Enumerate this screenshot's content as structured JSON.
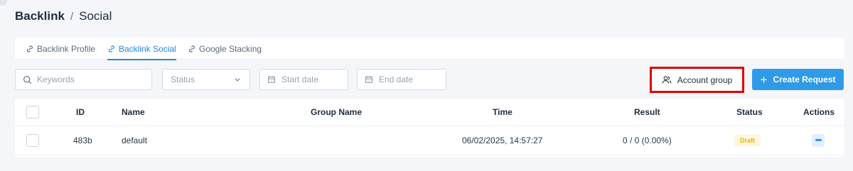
{
  "breadcrumb": {
    "root": "Backlink",
    "separator": "/",
    "current": "Social"
  },
  "tabs": [
    {
      "label": "Backlink Profile",
      "icon": "link-icon",
      "active": false
    },
    {
      "label": "Backlink Social",
      "icon": "link-icon",
      "active": true
    },
    {
      "label": "Google Stacking",
      "icon": "link-icon",
      "active": false
    }
  ],
  "filters": {
    "keywords_placeholder": "Keywords",
    "status_placeholder": "Status",
    "start_date_placeholder": "Start date",
    "end_date_placeholder": "End date"
  },
  "buttons": {
    "account_group": "Account group",
    "create_request": "Create Request",
    "create_plus": "+"
  },
  "table": {
    "columns": [
      "ID",
      "Name",
      "Group Name",
      "Time",
      "Result",
      "Status",
      "Actions"
    ],
    "rows": [
      {
        "id": "483b",
        "name": "default",
        "group_name": "",
        "time": "06/02/2025, 14:57:27",
        "result": "0 / 0 (0.00%)",
        "status": "Draft",
        "actions": "•••"
      }
    ]
  },
  "colors": {
    "accent": "#1e88e5",
    "create_button": "#2f9be8",
    "highlight_border": "#e00000",
    "draft_badge_text": "#f2b200",
    "draft_badge_bg": "#fff6db"
  }
}
